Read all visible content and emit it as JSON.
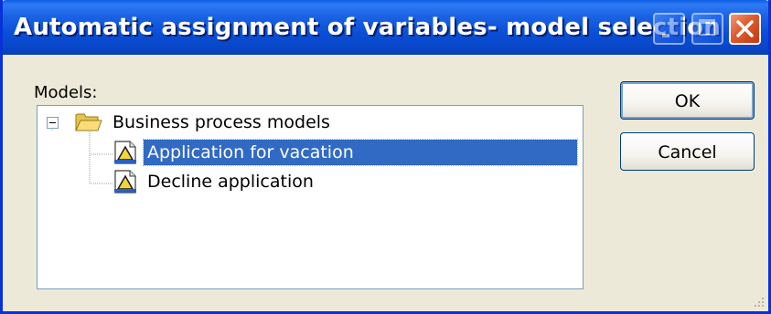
{
  "window": {
    "title": "Automatic assignment of variables- model selection",
    "colors": {
      "titlebar": "#0a4fd8",
      "selection": "#316ac5",
      "face": "#ece9d8"
    }
  },
  "titlebar_buttons": {
    "minimize_icon": "minimize-icon",
    "maximize_icon": "maximize-icon",
    "close_icon": "close-icon"
  },
  "models": {
    "label": "Models:",
    "tree": {
      "root": {
        "label": "Business process models",
        "icon": "folder-icon",
        "expanded": true
      },
      "children": [
        {
          "label": "Application for vacation",
          "icon": "process-model-icon",
          "selected": true
        },
        {
          "label": "Decline application",
          "icon": "process-model-icon",
          "selected": false
        }
      ]
    }
  },
  "buttons": {
    "ok": "OK",
    "cancel": "Cancel"
  }
}
